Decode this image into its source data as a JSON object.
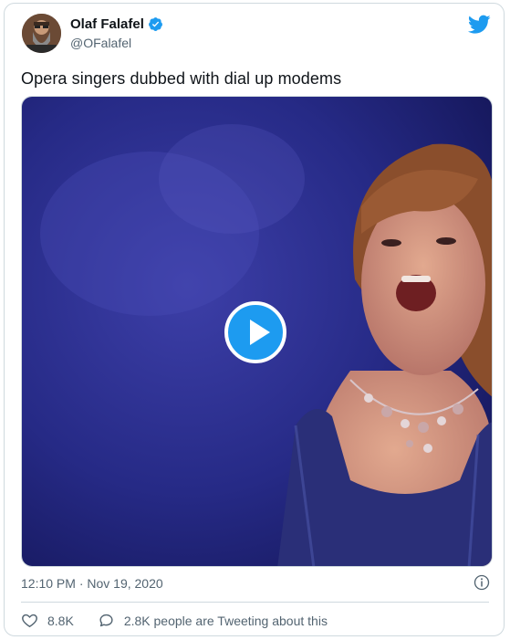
{
  "author": {
    "name": "Olaf Falafel",
    "handle": "@OFalafel",
    "verified": true
  },
  "tweet": {
    "text": "Opera singers dubbed with dial up modems",
    "timestamp": "12:10 PM · Nov 19, 2020"
  },
  "media": {
    "type": "video"
  },
  "stats": {
    "likes": "8.8K",
    "tweeting": "2.8K people are Tweeting about this"
  },
  "colors": {
    "brand": "#1d9bf0",
    "text": "#0f1419",
    "secondary": "#536471",
    "border": "#cfd9de"
  },
  "icons": [
    "avatar",
    "verified-badge-icon",
    "twitter-bird-icon",
    "play-icon",
    "info-icon",
    "heart-icon",
    "speech-bubble-icon"
  ]
}
